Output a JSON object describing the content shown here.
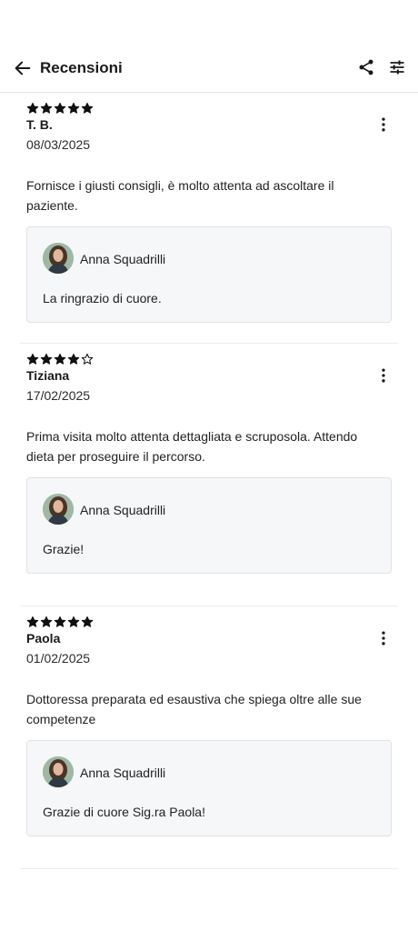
{
  "header": {
    "title": "Recensioni",
    "back_icon": "arrow-left-icon",
    "share_icon": "share-icon",
    "filter_icon": "sliders-icon"
  },
  "reviews": [
    {
      "rating": 5,
      "max_rating": 5,
      "author": "T. B.",
      "date": "08/03/2025",
      "text": "Fornisce i giusti consigli, è molto attenta ad ascoltare il paziente.",
      "reply": {
        "author": "Anna Squadrilli",
        "text": "La ringrazio di cuore."
      }
    },
    {
      "rating": 4,
      "max_rating": 5,
      "author": "Tiziana",
      "date": "17/02/2025",
      "text": "Prima visita molto attenta dettagliata e scruposola. Attendo dieta per proseguire il percorso.",
      "reply": {
        "author": "Anna Squadrilli",
        "text": "Grazie!"
      }
    },
    {
      "rating": 5,
      "max_rating": 5,
      "author": "Paola",
      "date": "01/02/2025",
      "text": "Dottoressa preparata ed esaustiva che spiega oltre alle sue competenze",
      "reply": {
        "author": "Anna Squadrilli",
        "text": "Grazie di cuore Sig.ra Paola!"
      }
    }
  ],
  "colors": {
    "text": "#1b1b1b",
    "divider": "#ececec",
    "reply_background": "#f6f7f9",
    "reply_border": "#dfe2e6"
  }
}
